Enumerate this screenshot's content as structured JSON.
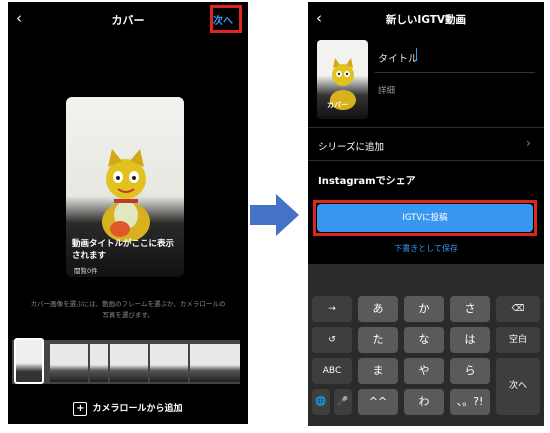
{
  "left": {
    "title": "カバー",
    "next_label": "次へ",
    "card_caption": "動画タイトルがここに表示されます",
    "card_views": "閲覧0件",
    "hint": "カバー画像を選ぶには、動画のフレームを選ぶか、カメラロールの写真を選びます。",
    "camera_roll_label": "カメラロールから追加"
  },
  "right": {
    "title": "新しいIGTV動画",
    "title_field": "タイトル",
    "detail_placeholder": "詳細",
    "thumb_caption": "カバー",
    "series_label": "シリーズに追加",
    "share_label": "Instagramでシェア",
    "post_button": "IGTVに投稿",
    "draft_link": "下書きとして保存"
  },
  "keyboard": {
    "row1": [
      "→",
      "あ",
      "か",
      "さ",
      "⌫"
    ],
    "row2": [
      "↺",
      "た",
      "な",
      "は",
      "空白"
    ],
    "row3": [
      "ABC",
      "ま",
      "や",
      "ら"
    ],
    "row4": [
      "🌐",
      "🎤",
      "^^",
      "わ",
      "、。?!"
    ],
    "enter": "次へ"
  },
  "colors": {
    "accent": "#3897f0",
    "highlight": "#e0261c",
    "arrow": "#4472c4"
  }
}
